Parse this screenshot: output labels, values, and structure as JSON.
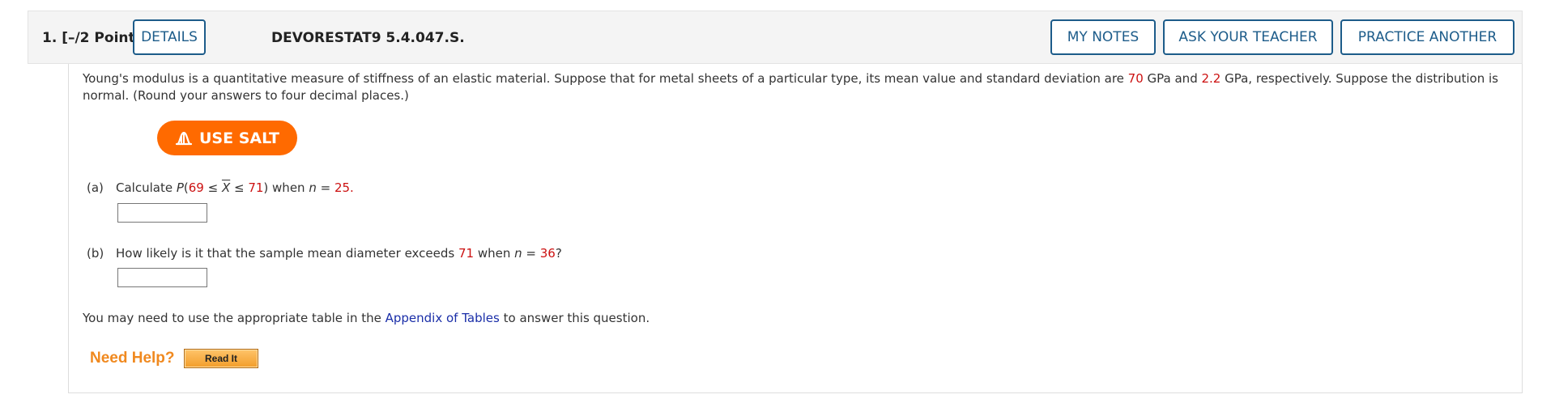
{
  "question": {
    "number_label": "1.  [–/2 Points]",
    "code": "DEVORESTAT9 5.4.047.S."
  },
  "buttons": {
    "details": "DETAILS",
    "my_notes": "MY NOTES",
    "ask_teacher": "ASK YOUR TEACHER",
    "practice": "PRACTICE ANOTHER"
  },
  "intro": {
    "text1": "Young's modulus is a quantitative measure of stiffness of an elastic material. Suppose that for metal sheets of a particular type, its mean value and standard deviation are ",
    "mean": "70",
    "text2": " GPa and ",
    "sd": "2.2",
    "text3": " GPa, respectively. Suppose the distribution is normal. (Round your answers to four decimal places.)"
  },
  "salt": {
    "label": "USE SALT",
    "icon": "salt-distribution-icon"
  },
  "part_a": {
    "letter": "(a)",
    "pre": "Calculate ",
    "p": "P",
    "open": "(",
    "low": "69",
    "le1": " ≤ ",
    "xbar": "X",
    "le2": " ≤ ",
    "high": "71",
    "close": ") when ",
    "n": "n",
    "eq": " = ",
    "n_value": "25",
    "end": ".",
    "answer": ""
  },
  "part_b": {
    "letter": "(b)",
    "pre": "How likely is it that the sample mean diameter exceeds ",
    "threshold": "71",
    "mid": " when ",
    "n": "n",
    "eq": " = ",
    "n_value": "36",
    "end": "?",
    "answer": ""
  },
  "appendix": {
    "pre": "You may need to use the appropriate table in the ",
    "link": "Appendix of Tables",
    "post": " to answer this question."
  },
  "help": {
    "label": "Need Help?",
    "read_it": "Read It"
  },
  "colors": {
    "accent_blue": "#1d5c8a",
    "value_red": "#cc1111",
    "salt_orange": "#ff6a00",
    "help_orange": "#f0891f",
    "link_blue": "#1a2ea8"
  }
}
